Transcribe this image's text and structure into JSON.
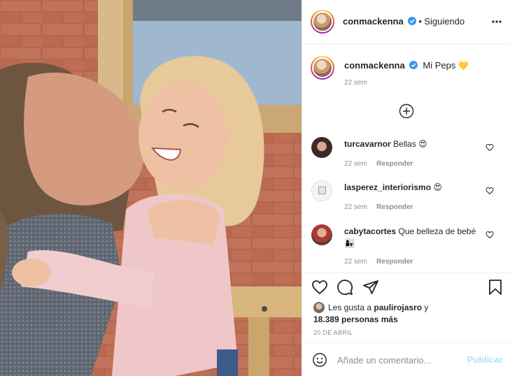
{
  "header": {
    "username": "conmackenna",
    "separator": "•",
    "follow_status": "Siguiendo",
    "more_icon": "more-horizontal-icon"
  },
  "caption": {
    "username": "conmackenna",
    "text": "Mi Peps",
    "emoji": "💛",
    "time": "22 sem"
  },
  "load_more_icon": "plus-circle-icon",
  "comments": [
    {
      "username": "turcavarnor",
      "text": "Bellas",
      "emoji": "😍",
      "time": "22 sem",
      "reply": "Responder"
    },
    {
      "username": "lasperez_interiorismo",
      "text": "",
      "emoji": "😍",
      "time": "22 sem",
      "reply": "Responder"
    },
    {
      "username": "cabytacortes",
      "text": "Que belleza de bebé",
      "emoji": "👩‍👧",
      "time": "22 sem",
      "reply": "Responder"
    }
  ],
  "actions": {
    "like_icon": "heart-icon",
    "comment_icon": "comment-icon",
    "share_icon": "send-icon",
    "save_icon": "bookmark-icon"
  },
  "likes": {
    "prefix": "Les gusta a",
    "user": "paulirojasro",
    "conjunction": "y",
    "count_text": "18.389 personas más"
  },
  "date": "20 DE ABRIL",
  "add_comment": {
    "placeholder": "Añade un comentario...",
    "post_label": "Publicar",
    "emoji_icon": "smiley-icon"
  },
  "colors": {
    "verified": "#3897f0",
    "link_disabled": "#b2dffc",
    "muted": "#8e8e8e",
    "border": "#efefef"
  }
}
